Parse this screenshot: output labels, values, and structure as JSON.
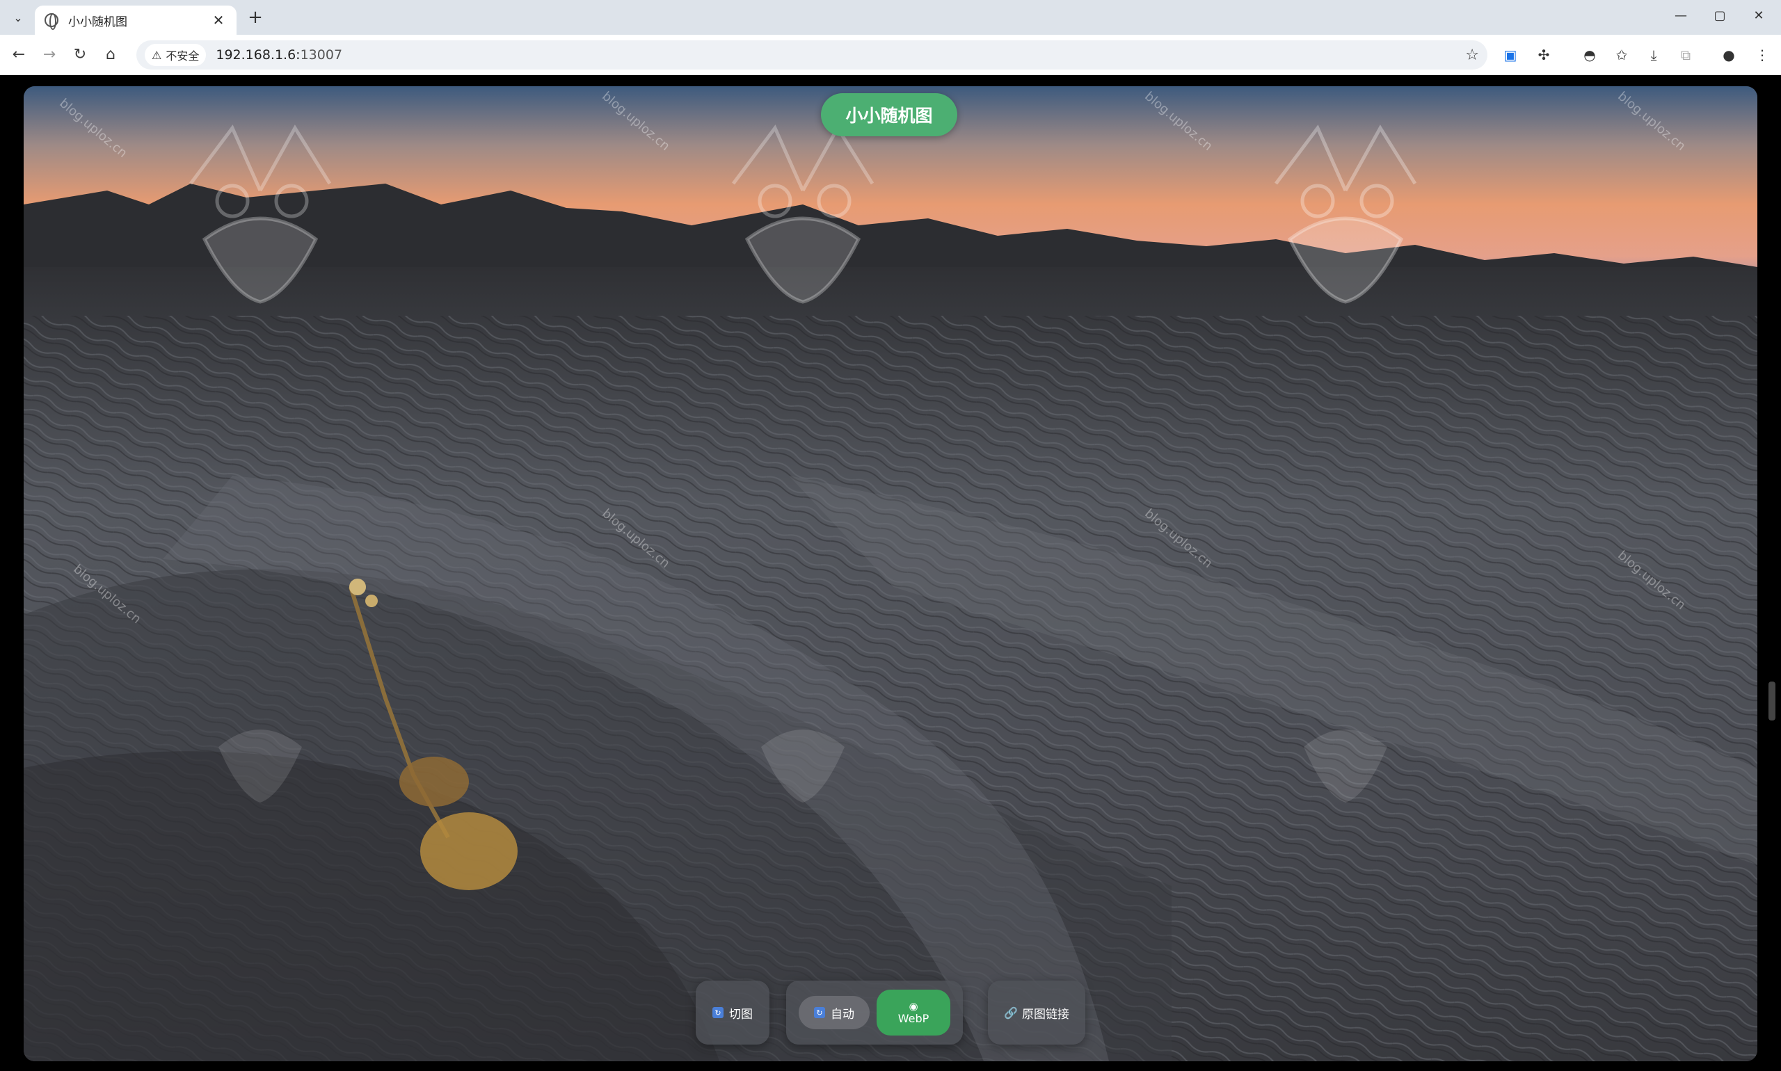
{
  "browser": {
    "tab_title": "小小随机图",
    "tab_close": "✕",
    "new_tab": "+",
    "window_controls": [
      "—",
      "▢",
      "✕"
    ],
    "security_label": "不安全",
    "url_host": "192.168.1.6:",
    "url_port": "13007"
  },
  "page": {
    "title": "小小随机图",
    "watermark": "blog.uploz.cn",
    "controls": {
      "switch_label": "切图",
      "auto_label": "自动",
      "webp_label": "WebP",
      "original_link_label": "原图链接"
    }
  },
  "icons": {
    "back": "back-arrow-icon",
    "forward": "forward-arrow-icon",
    "reload": "reload-icon",
    "home": "home-icon",
    "bookmark": "star-icon",
    "link": "link-icon"
  },
  "colors": {
    "title_pill": "#4caf72",
    "webp_active": "#3aa45a"
  }
}
